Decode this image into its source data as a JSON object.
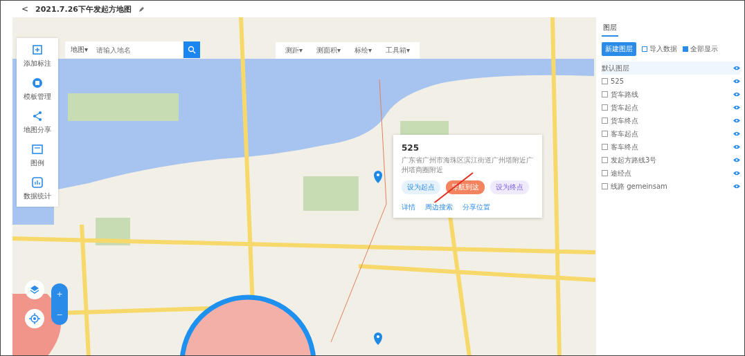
{
  "header": {
    "back": "<",
    "title": "2021.7.26下午发起方地图"
  },
  "search": {
    "scope": "地图▾",
    "placeholder": "请输入地名"
  },
  "toolbar": [
    {
      "label": "测距▾"
    },
    {
      "label": "测面积▾"
    },
    {
      "label": "标绘▾"
    },
    {
      "label": "工具箱▾"
    }
  ],
  "sidebar": [
    {
      "kind": "marker",
      "label": "添加标注"
    },
    {
      "kind": "template",
      "label": "模板管理"
    },
    {
      "kind": "share",
      "label": "地图分享"
    },
    {
      "kind": "legend",
      "label": "图例"
    },
    {
      "kind": "stats",
      "label": "数据统计"
    }
  ],
  "panel": {
    "tab": "图层",
    "new_button": "新建图层",
    "actions": [
      {
        "kind": "import",
        "label": "导入数据"
      },
      {
        "kind": "show",
        "label": "全部显示"
      }
    ],
    "layers": [
      {
        "kind": "group",
        "label": "默认图层"
      },
      {
        "kind": "layer",
        "label": "525",
        "checked": false
      },
      {
        "kind": "layer",
        "label": "货车路线",
        "checked": false
      },
      {
        "kind": "layer",
        "label": "货车起点",
        "checked": false
      },
      {
        "kind": "layer",
        "label": "货车终点",
        "checked": false
      },
      {
        "kind": "layer",
        "label": "客车起点",
        "checked": false
      },
      {
        "kind": "layer",
        "label": "客车终点",
        "checked": false
      },
      {
        "kind": "layer",
        "label": "发起方路线3号",
        "checked": false
      },
      {
        "kind": "layer",
        "label": "途经点",
        "checked": false
      },
      {
        "kind": "layer",
        "label": "线路 gemeinsam",
        "checked": false
      }
    ]
  },
  "popup": {
    "title": "525",
    "address": "广东省广州市海珠区滨江街道广州塔附近广州塔商圈附近",
    "actions": [
      {
        "kind": "start",
        "label": "设为起点"
      },
      {
        "kind": "nav",
        "label": "导航到这"
      },
      {
        "kind": "end",
        "label": "设为终点"
      }
    ],
    "links": [
      "详情",
      "周边搜索",
      "分享位置"
    ]
  },
  "zoom": {
    "in": "+",
    "out": "−"
  }
}
